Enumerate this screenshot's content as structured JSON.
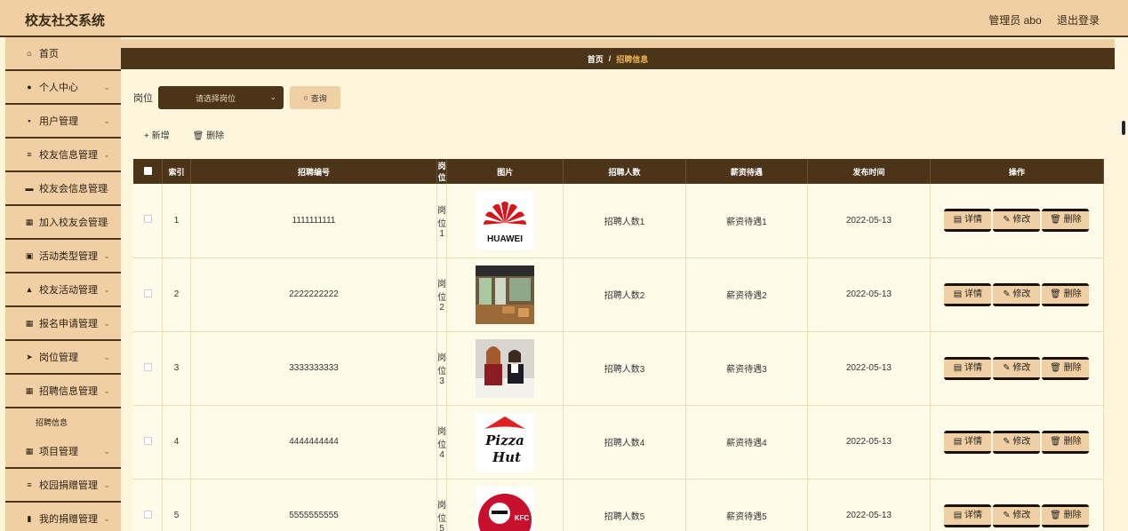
{
  "header": {
    "title": "校友社交系统",
    "user": "管理员 abo",
    "logout": "退出登录"
  },
  "sidebar": {
    "items": [
      {
        "label": "首页",
        "icon": "home-icon",
        "glyph": "⌂",
        "chevron": false
      },
      {
        "label": "个人中心",
        "icon": "user-icon",
        "glyph": "●",
        "chevron": true
      },
      {
        "label": "用户管理",
        "icon": "users-icon",
        "glyph": "▪",
        "chevron": true
      },
      {
        "label": "校友信息管理",
        "icon": "sliders-icon",
        "glyph": "≡",
        "chevron": true
      },
      {
        "label": "校友会信息管理",
        "icon": "bank-icon",
        "glyph": "▬",
        "chevron": true
      },
      {
        "label": "加入校友会管理",
        "icon": "grid-icon",
        "glyph": "▦",
        "chevron": true
      },
      {
        "label": "活动类型管理",
        "icon": "clipboard-icon",
        "glyph": "▣",
        "chevron": true
      },
      {
        "label": "校友活动管理",
        "icon": "thumb-icon",
        "glyph": "▲",
        "chevron": true
      },
      {
        "label": "报名申请管理",
        "icon": "grid-icon",
        "glyph": "▦",
        "chevron": true
      },
      {
        "label": "岗位管理",
        "icon": "send-icon",
        "glyph": "➤",
        "chevron": true
      },
      {
        "label": "招聘信息管理",
        "icon": "grid-icon",
        "glyph": "▦",
        "chevron": true
      }
    ],
    "submenu": "招聘信息",
    "items_after": [
      {
        "label": "项目管理",
        "icon": "grid-icon",
        "glyph": "▦",
        "chevron": true
      },
      {
        "label": "校园捐赠管理",
        "icon": "list-icon",
        "glyph": "≡",
        "chevron": true
      },
      {
        "label": "我的捐赠管理",
        "icon": "bar-chart-icon",
        "glyph": "▮",
        "chevron": true
      }
    ]
  },
  "breadcrumb": {
    "home": "首页",
    "separator": "/",
    "current": "招聘信息"
  },
  "search": {
    "label": "岗位",
    "placeholder": "请选择岗位",
    "button": "查询"
  },
  "toolbar": {
    "add": "新增",
    "delete": "删除"
  },
  "table": {
    "columns": [
      "索引",
      "招聘编号",
      "岗位",
      "图片",
      "招聘人数",
      "薪资待遇",
      "发布时间",
      "操作"
    ],
    "rows": [
      {
        "index": "1",
        "code": "1111111111",
        "post": "岗位1",
        "image": "huawei-logo",
        "count": "招聘人数1",
        "salary": "薪资待遇1",
        "date": "2022-05-13"
      },
      {
        "index": "2",
        "code": "2222222222",
        "post": "岗位2",
        "image": "cafe-photo",
        "count": "招聘人数2",
        "salary": "薪资待遇2",
        "date": "2022-05-13"
      },
      {
        "index": "3",
        "code": "3333333333",
        "post": "岗位3",
        "image": "interview-photo",
        "count": "招聘人数3",
        "salary": "薪资待遇3",
        "date": "2022-05-13"
      },
      {
        "index": "4",
        "code": "4444444444",
        "post": "岗位4",
        "image": "pizzahut-logo",
        "count": "招聘人数4",
        "salary": "薪资待遇4",
        "date": "2022-05-13"
      },
      {
        "index": "5",
        "code": "5555555555",
        "post": "岗位5",
        "image": "kfc-logo",
        "count": "招聘人数5",
        "salary": "薪资待遇5",
        "date": "2022-05-13"
      }
    ],
    "ops": {
      "detail": "详情",
      "edit": "修改",
      "remove": "删除"
    }
  },
  "colors": {
    "header_bg": "#efcfa3",
    "dark_brown": "#4c3418",
    "page_bg": "#fdf6dd",
    "accent": "#efb655"
  }
}
